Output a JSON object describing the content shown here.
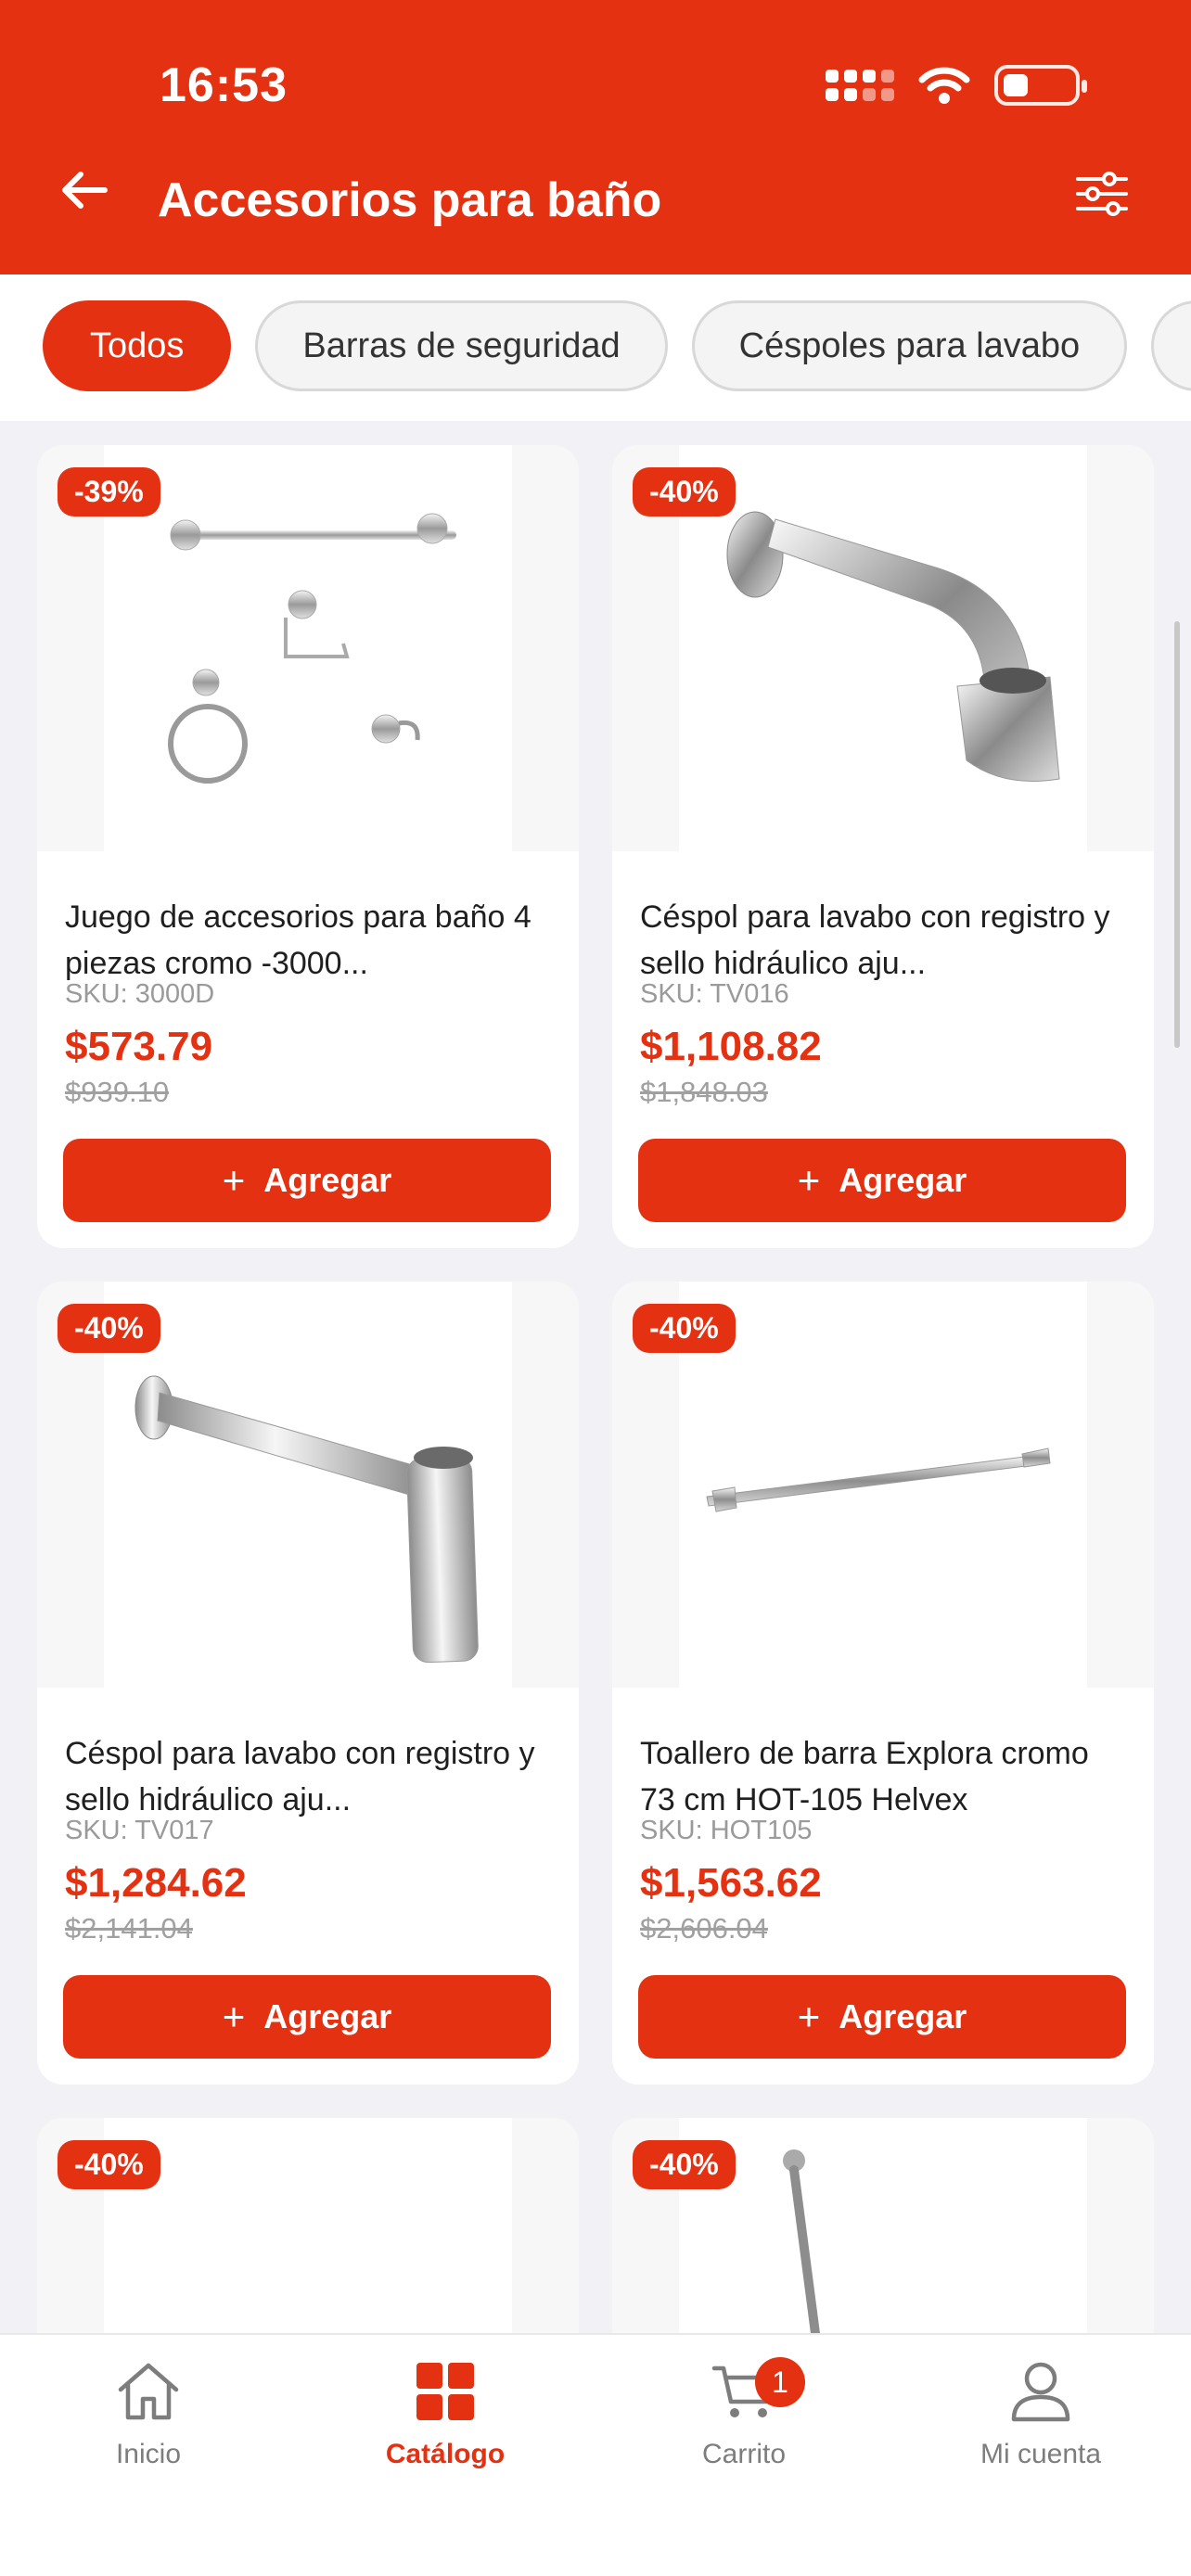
{
  "status_bar": {
    "time": "16:53"
  },
  "header": {
    "title": "Accesorios para baño"
  },
  "categories": [
    {
      "label": "Todos",
      "active": true
    },
    {
      "label": "Barras de seguridad",
      "active": false
    },
    {
      "label": "Céspoles para lavabo",
      "active": false
    }
  ],
  "products": [
    {
      "discount": "-39%",
      "name": "Juego de accesorios para baño 4 piezas cromo -3000...",
      "sku": "SKU: 3000D",
      "price": "$573.79",
      "old_price": "$939.10",
      "add_label": "Agregar",
      "image": "bath-accessory-set-image"
    },
    {
      "discount": "-40%",
      "name": "Céspol para lavabo con registro y sello hidráulico aju...",
      "sku": "SKU: TV016",
      "price": "$1,108.82",
      "old_price": "$1,848.03",
      "add_label": "Agregar",
      "image": "sink-trap-curved-image"
    },
    {
      "discount": "-40%",
      "name": "Céspol para lavabo con registro y sello hidráulico aju...",
      "sku": "SKU: TV017",
      "price": "$1,284.62",
      "old_price": "$2,141.04",
      "add_label": "Agregar",
      "image": "sink-trap-bottle-image"
    },
    {
      "discount": "-40%",
      "name": "Toallero de barra Explora cromo 73 cm HOT-105 Helvex",
      "sku": "SKU: HOT105",
      "price": "$1,563.62",
      "old_price": "$2,606.04",
      "add_label": "Agregar",
      "image": "towel-bar-image"
    },
    {
      "discount": "-40%",
      "image": "product-image"
    },
    {
      "discount": "-40%",
      "image": "shower-rod-image"
    }
  ],
  "tabbar": {
    "items": [
      {
        "label": "Inicio",
        "icon": "home-icon",
        "active": false
      },
      {
        "label": "Catálogo",
        "icon": "grid-icon",
        "active": true
      },
      {
        "label": "Carrito",
        "icon": "cart-icon",
        "active": false,
        "badge": "1"
      },
      {
        "label": "Mi cuenta",
        "icon": "user-icon",
        "active": false
      }
    ]
  },
  "colors": {
    "primary": "#e33112",
    "background": "#f2f2f6",
    "muted": "#9a9a9a"
  }
}
